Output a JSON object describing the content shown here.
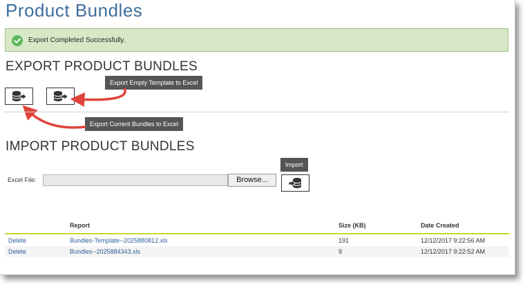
{
  "page": {
    "title": "Product Bundles"
  },
  "alert": {
    "message": "Export Completed Successfully.",
    "icon": "check-circle-icon",
    "color": "#5cb85c"
  },
  "export": {
    "heading": "EXPORT PRODUCT BUNDLES",
    "current_button_icon": "database-export-icon",
    "template_button_icon": "database-export-icon",
    "tooltip_template": "Export Empty Template to Excel",
    "tooltip_current": "Export Current Bundles to Excel"
  },
  "import": {
    "heading": "IMPORT PRODUCT BUNDLES",
    "file_label": "Excel File:",
    "file_value": "",
    "browse_label": "Browse...",
    "tooltip_import": "Import",
    "import_button_icon": "database-import-icon"
  },
  "table": {
    "columns": [
      "",
      "Report",
      "Size (KB)",
      "Date Created"
    ],
    "rows": [
      {
        "action": "Delete",
        "report": "Bundles-Template--2025880812.xls",
        "size": "191",
        "date": "12/12/2017 9:22:56 AM"
      },
      {
        "action": "Delete",
        "report": "Bundles--2025884343.xls",
        "size": "9",
        "date": "12/12/2017 9:22:52 AM"
      }
    ]
  },
  "colors": {
    "title": "#3f6d9e",
    "arrow": "#e0423a",
    "accent_line": "#c6d72c",
    "tooltip_bg": "#555555"
  }
}
